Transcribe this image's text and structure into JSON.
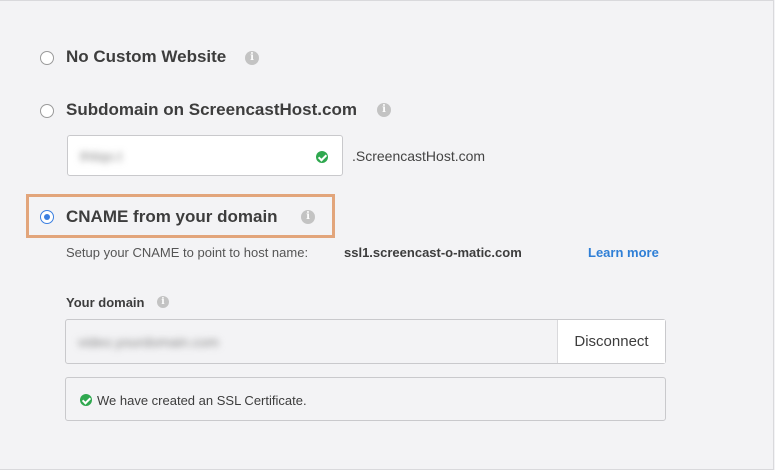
{
  "options": {
    "no_custom": {
      "label": "No Custom Website",
      "selected": false
    },
    "subdomain": {
      "label": "Subdomain on ScreencastHost.com",
      "selected": false,
      "input_value": "thtiqo.t",
      "suffix": ".ScreencastHost.com"
    },
    "cname": {
      "label": "CNAME from your domain",
      "selected": true,
      "setup_text": "Setup your CNAME to point to host name:",
      "host_name": "ssl1.screencast-o-matic.com",
      "learn_more": "Learn more",
      "domain_label": "Your domain",
      "domain_value": "video.yourdomain.com",
      "disconnect_label": "Disconnect",
      "ssl_notice": "We have created an SSL Certificate."
    }
  },
  "colors": {
    "accent": "#3b7fe0",
    "link": "#2f7fd6",
    "success": "#2fa84f",
    "highlight": "#e2a57b"
  },
  "icons": {
    "info": "i"
  }
}
